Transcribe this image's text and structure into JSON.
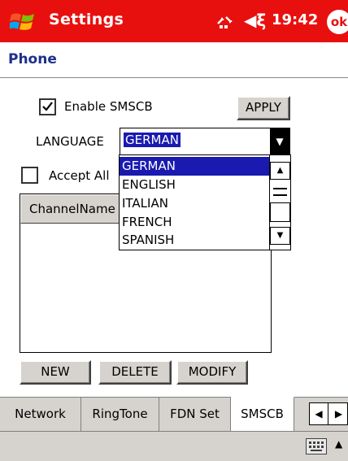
{
  "titlebar": {
    "title": "Settings",
    "clock": "19:42",
    "ok_label": "ok",
    "volume_glyph": "◀ξ"
  },
  "header": {
    "title": "Phone"
  },
  "form": {
    "enable_smscb_label": "Enable SMSCB",
    "enable_smscb_checked": true,
    "apply_label": "APPLY",
    "language_label": "LANGUAGE",
    "language_value": "GERMAN",
    "language_options": [
      "GERMAN",
      "ENGLISH",
      "ITALIAN",
      "FRENCH",
      "SPANISH"
    ],
    "accept_all_label": "Accept All",
    "accept_all_checked": false
  },
  "listview": {
    "column_header": "ChannelName"
  },
  "buttons": {
    "new": "NEW",
    "delete": "DELETE",
    "modify": "MODIFY"
  },
  "tabs": [
    {
      "label": "Network",
      "active": false
    },
    {
      "label": "RingTone",
      "active": false
    },
    {
      "label": "FDN Set",
      "active": false
    },
    {
      "label": "SMSCB",
      "active": true
    }
  ],
  "icons": {
    "start": "windows-flag-icon",
    "connectivity": "connectivity-icon",
    "volume": "volume-icon",
    "keyboard": "keyboard-icon"
  },
  "colors": {
    "titlebar": "#e8100e",
    "header_text": "#1c2f8c",
    "selection": "#1a1ab0",
    "chrome": "#d6d3ce"
  }
}
